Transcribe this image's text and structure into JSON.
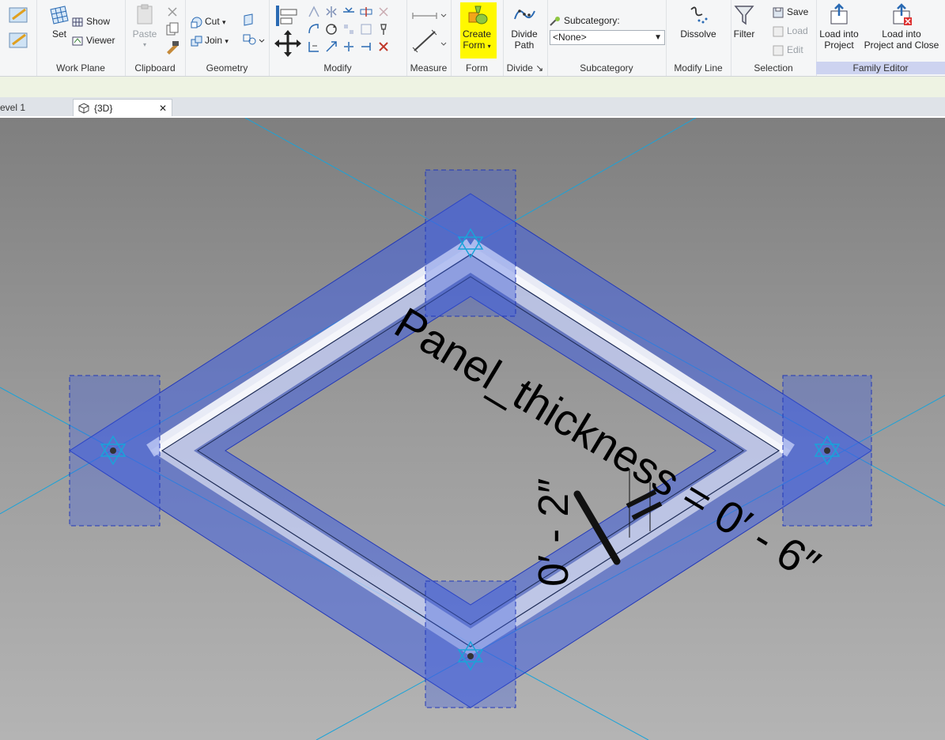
{
  "ribbon": {
    "panels": {
      "work_plane": "Work Plane",
      "clipboard": "Clipboard",
      "geometry": "Geometry",
      "modify": "Modify",
      "measure": "Measure",
      "form": "Form",
      "divide": "Divide ↘",
      "subcategory": "Subcategory",
      "modify_line": "Modify Line",
      "selection": "Selection",
      "family_editor": "Family Editor"
    },
    "work_plane": {
      "set": "Set",
      "show": "Show",
      "viewer": "Viewer"
    },
    "clipboard": {
      "paste": "Paste"
    },
    "geometry": {
      "cut": "Cut",
      "join": "Join"
    },
    "form": {
      "create_form_line1": "Create",
      "create_form_line2": "Form"
    },
    "divide": {
      "divide_path_line1": "Divide",
      "divide_path_line2": "Path"
    },
    "subcategory": {
      "label": "Subcategory:",
      "value": "<None>"
    },
    "modify_line": {
      "dissolve": "Dissolve"
    },
    "selection": {
      "filter": "Filter",
      "save": "Save",
      "load": "Load",
      "edit": "Edit"
    },
    "family_editor": {
      "load_into_project_line1": "Load into",
      "load_into_project_line2": "Project",
      "load_close_line1": "Load into",
      "load_close_line2": "Project and Close"
    }
  },
  "tabs": {
    "level1": "evel 1",
    "view3d": "{3D}",
    "close_glyph": "✕"
  },
  "viewport": {
    "dimension_main": "Panel_thickness = 0′ - 6″",
    "dimension_small": "0′ - 2″"
  },
  "colors": {
    "ribbon_bg": "#f5f6f7",
    "option_bar": "#eef3e3",
    "viewport_bg": "#a9a9a9",
    "selection_blue": "#3f5fe0",
    "highlight_yellow": "#fff800",
    "ref_line_cyan": "#1aa3d9"
  }
}
